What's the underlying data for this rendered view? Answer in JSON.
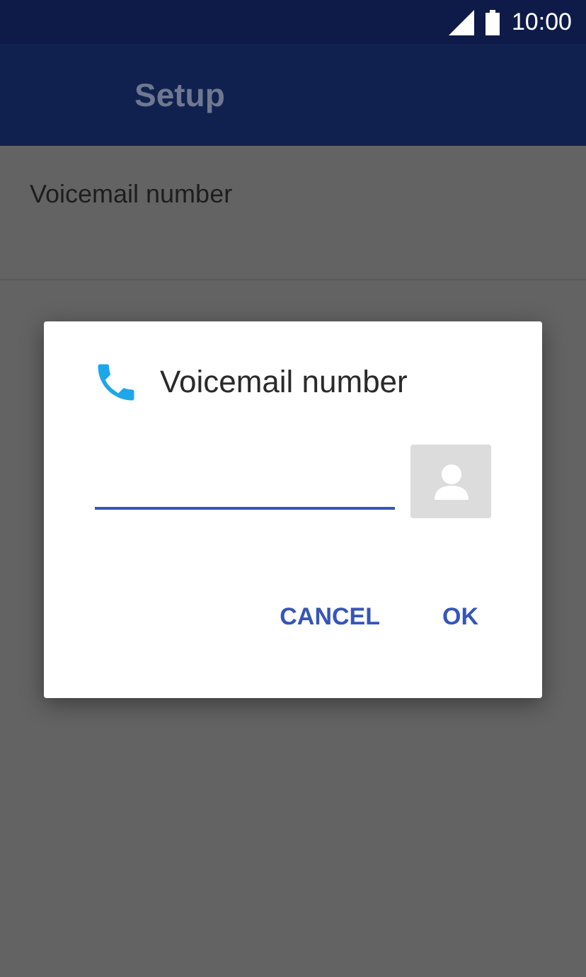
{
  "status_bar": {
    "time": "10:00"
  },
  "app_bar": {
    "title": "Setup"
  },
  "list": [
    {
      "label": "Voicemail number"
    }
  ],
  "dialog": {
    "title": "Voicemail number",
    "field": {
      "focused": true
    },
    "buttons": [
      "CANCEL",
      "OK"
    ]
  }
}
